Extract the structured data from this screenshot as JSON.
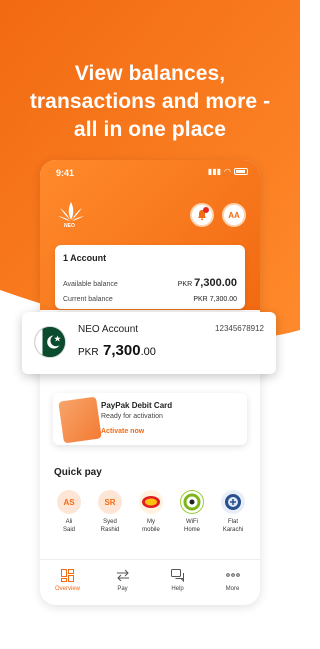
{
  "colors": {
    "accent": "#f26a12",
    "accent_light": "#ff8a2b",
    "flag_green": "#0b4b2e"
  },
  "headline": {
    "line1": "View balances,",
    "line2": "transactions and more -",
    "line3": "all in one place"
  },
  "status_bar": {
    "time": "9:41"
  },
  "header": {
    "logo_text": "NEO",
    "avatar_initials": "AA"
  },
  "account_card": {
    "title": "1 Account",
    "available_label": "Available balance",
    "available_currency": "PKR",
    "available_amount": "7,300.00",
    "current_label": "Current balance",
    "current_currency": "PKR",
    "current_amount": "7,300.00"
  },
  "neo_account": {
    "name": "NEO Account",
    "number": "12345678912",
    "currency": "PKR",
    "amount": "7,300",
    "decimals": ".00"
  },
  "debit_card": {
    "title": "PayPak Debit Card",
    "status": "Ready for activation",
    "action": "Activate now"
  },
  "quick_pay": {
    "title": "Quick pay",
    "items": [
      {
        "initials": "AS",
        "label1": "Ali",
        "label2": "Said"
      },
      {
        "initials": "SR",
        "label1": "Syed",
        "label2": "Rashid"
      },
      {
        "initials": "",
        "label1": "My",
        "label2": "mobile"
      },
      {
        "initials": "",
        "label1": "WiFi",
        "label2": "Home"
      },
      {
        "initials": "",
        "label1": "Flat",
        "label2": "Karachi"
      }
    ]
  },
  "tabs": [
    {
      "label": "Overview",
      "icon": "overview-icon",
      "active": true
    },
    {
      "label": "Pay",
      "icon": "transfer-icon",
      "active": false
    },
    {
      "label": "Help",
      "icon": "chat-icon",
      "active": false
    },
    {
      "label": "More",
      "icon": "more-dots-icon",
      "active": false
    }
  ]
}
